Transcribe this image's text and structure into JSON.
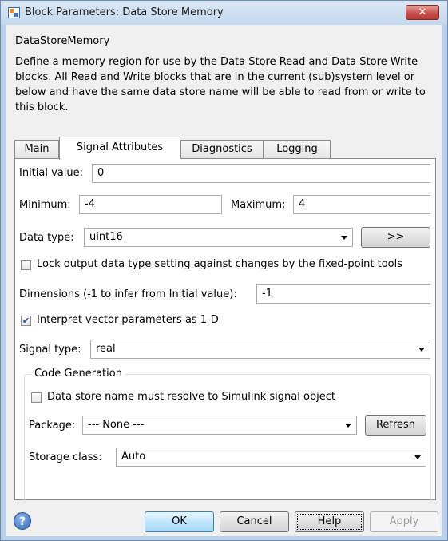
{
  "window": {
    "title": "Block Parameters: Data Store Memory",
    "close_symbol": "✕"
  },
  "description": {
    "group_title": "DataStoreMemory",
    "text": "Define a memory region for use by the Data Store Read and Data Store Write blocks. All Read and Write blocks that are in the current (sub)system level or below and have the same data store name will be able to read from or write to this block."
  },
  "tabs": [
    {
      "label": "Main"
    },
    {
      "label": "Signal Attributes"
    },
    {
      "label": "Diagnostics"
    },
    {
      "label": "Logging"
    }
  ],
  "signal_attributes": {
    "initial_value_label": "Initial value:",
    "initial_value": "0",
    "minimum_label": "Minimum:",
    "minimum": "-4",
    "maximum_label": "Maximum:",
    "maximum": "4",
    "data_type_label": "Data type:",
    "data_type": "uint16",
    "assistant_button": ">>",
    "lock_label": "Lock output data type setting against changes by the fixed-point tools",
    "lock_checked": false,
    "dimensions_label": "Dimensions (-1 to infer from Initial value):",
    "dimensions": "-1",
    "interpret_label": "Interpret vector parameters as 1-D",
    "interpret_checked": true,
    "check_mark": "✔",
    "signal_type_label": "Signal type:",
    "signal_type": "real"
  },
  "code_generation": {
    "title": "Code Generation",
    "resolve_label": "Data store name must resolve to Simulink signal object",
    "resolve_checked": false,
    "package_label": "Package:",
    "package": "--- None ---",
    "refresh_button": "Refresh",
    "storage_class_label": "Storage class:",
    "storage_class": "Auto"
  },
  "footer": {
    "help_icon_glyph": "?",
    "ok": "OK",
    "cancel": "Cancel",
    "help": "Help",
    "apply": "Apply"
  }
}
